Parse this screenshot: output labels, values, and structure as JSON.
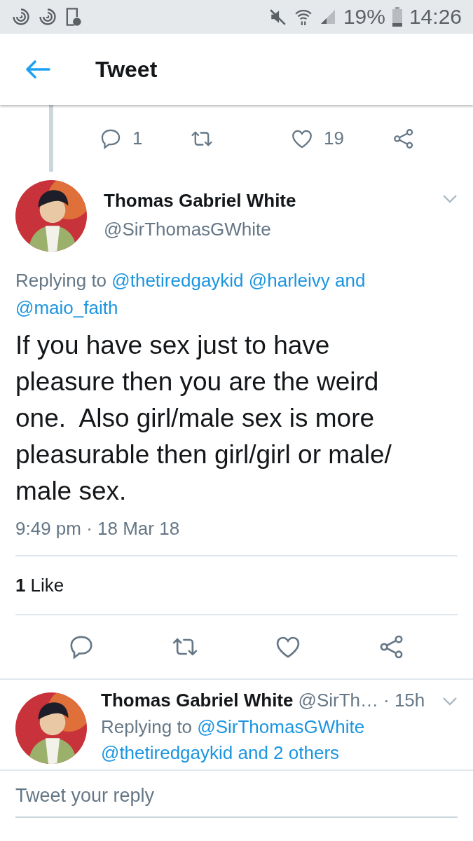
{
  "status_bar": {
    "battery": "19%",
    "time": "14:26"
  },
  "header": {
    "title": "Tweet"
  },
  "previous_tweet": {
    "actions": [
      {
        "kind": "reply",
        "count": "1"
      },
      {
        "kind": "retweet"
      },
      {
        "kind": "like",
        "count": "19"
      },
      {
        "kind": "share"
      }
    ]
  },
  "tweet": {
    "name": "Thomas Gabriel White",
    "handle": "@SirThomasGWhite",
    "replying_label": "Replying to",
    "replying_targets": [
      "@thetiredgaykid",
      "@harleivy and",
      "@maio_faith"
    ],
    "text": "If you have sex just to have pleasure then you are the weird one.  Also girl/male sex is more pleasurable then girl/girl or male/ male sex.",
    "timestamp": "9:49 pm · 18 Mar 18",
    "likes_count": "1",
    "likes_label": "Like",
    "actions": [
      {
        "kind": "reply"
      },
      {
        "kind": "retweet"
      },
      {
        "kind": "like"
      },
      {
        "kind": "share"
      }
    ]
  },
  "reply": {
    "name": "Thomas Gabriel White",
    "handle": "@SirTh…",
    "time": "· 15h",
    "replying_label": "Replying to",
    "replying_targets": [
      "@SirThomasGWhite",
      "@thetiredgaykid and 2 others"
    ]
  },
  "composer": {
    "placeholder": "Tweet your reply"
  }
}
